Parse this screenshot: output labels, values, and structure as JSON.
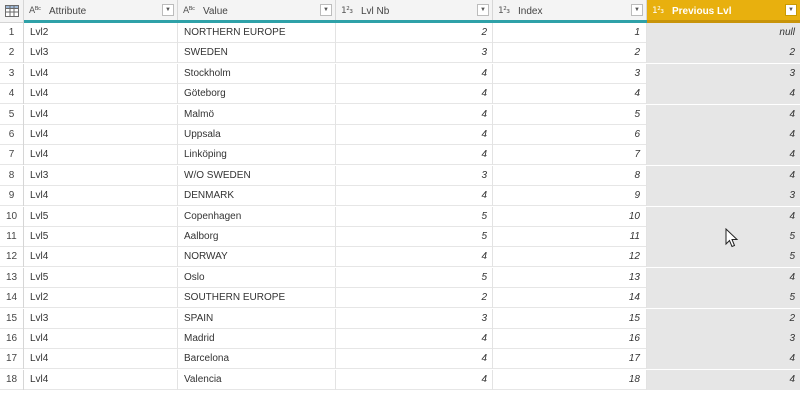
{
  "columns": [
    {
      "type_icon": "ABC",
      "name": "Attribute"
    },
    {
      "type_icon": "123",
      "name": "Value"
    },
    {
      "type_icon": "123",
      "name": "Lvl Nb"
    },
    {
      "type_icon": "123",
      "name": "Index"
    },
    {
      "type_icon": "123",
      "name": "Previous Lvl"
    }
  ],
  "header": {
    "attribute": {
      "type": "Aᴮᶜ",
      "label": "Attribute"
    },
    "value": {
      "type": "Aᴮᶜ",
      "label": "Value"
    },
    "lvl_nb": {
      "type": "1²₃",
      "label": "Lvl Nb"
    },
    "index": {
      "type": "1²₃",
      "label": "Index"
    },
    "previous_lvl": {
      "type": "1²₃",
      "label": "Previous Lvl"
    }
  },
  "rows": [
    {
      "n": "1",
      "attribute": "Lvl2",
      "value": "NORTHERN EUROPE",
      "lvl_nb": "2",
      "index": "1",
      "previous_lvl": "null"
    },
    {
      "n": "2",
      "attribute": "Lvl3",
      "value": "SWEDEN",
      "lvl_nb": "3",
      "index": "2",
      "previous_lvl": "2"
    },
    {
      "n": "3",
      "attribute": "Lvl4",
      "value": "Stockholm",
      "lvl_nb": "4",
      "index": "3",
      "previous_lvl": "3"
    },
    {
      "n": "4",
      "attribute": "Lvl4",
      "value": "Göteborg",
      "lvl_nb": "4",
      "index": "4",
      "previous_lvl": "4"
    },
    {
      "n": "5",
      "attribute": "Lvl4",
      "value": "Malmö",
      "lvl_nb": "4",
      "index": "5",
      "previous_lvl": "4"
    },
    {
      "n": "6",
      "attribute": "Lvl4",
      "value": "Uppsala",
      "lvl_nb": "4",
      "index": "6",
      "previous_lvl": "4"
    },
    {
      "n": "7",
      "attribute": "Lvl4",
      "value": "Linköping",
      "lvl_nb": "4",
      "index": "7",
      "previous_lvl": "4"
    },
    {
      "n": "8",
      "attribute": "Lvl3",
      "value": "W/O SWEDEN",
      "lvl_nb": "3",
      "index": "8",
      "previous_lvl": "4"
    },
    {
      "n": "9",
      "attribute": "Lvl4",
      "value": "DENMARK",
      "lvl_nb": "4",
      "index": "9",
      "previous_lvl": "3"
    },
    {
      "n": "10",
      "attribute": "Lvl5",
      "value": "Copenhagen",
      "lvl_nb": "5",
      "index": "10",
      "previous_lvl": "4"
    },
    {
      "n": "11",
      "attribute": "Lvl5",
      "value": "Aalborg",
      "lvl_nb": "5",
      "index": "11",
      "previous_lvl": "5"
    },
    {
      "n": "12",
      "attribute": "Lvl4",
      "value": "NORWAY",
      "lvl_nb": "4",
      "index": "12",
      "previous_lvl": "5"
    },
    {
      "n": "13",
      "attribute": "Lvl5",
      "value": "Oslo",
      "lvl_nb": "5",
      "index": "13",
      "previous_lvl": "4"
    },
    {
      "n": "14",
      "attribute": "Lvl2",
      "value": "SOUTHERN EUROPE",
      "lvl_nb": "2",
      "index": "14",
      "previous_lvl": "5"
    },
    {
      "n": "15",
      "attribute": "Lvl3",
      "value": "SPAIN",
      "lvl_nb": "3",
      "index": "15",
      "previous_lvl": "2"
    },
    {
      "n": "16",
      "attribute": "Lvl4",
      "value": "Madrid",
      "lvl_nb": "4",
      "index": "16",
      "previous_lvl": "3"
    },
    {
      "n": "17",
      "attribute": "Lvl4",
      "value": "Barcelona",
      "lvl_nb": "4",
      "index": "17",
      "previous_lvl": "4"
    },
    {
      "n": "18",
      "attribute": "Lvl4",
      "value": "Valencia",
      "lvl_nb": "4",
      "index": "18",
      "previous_lvl": "4"
    }
  ],
  "colors": {
    "selected_header": "#e8b00e",
    "column_quality_bar": "#2ea1a8",
    "selected_column_bg": "#e6e6e6"
  },
  "icons": {
    "corner": "table-icon",
    "dropdown": "chevron-down-icon",
    "cursor": "mouse-pointer-icon"
  }
}
